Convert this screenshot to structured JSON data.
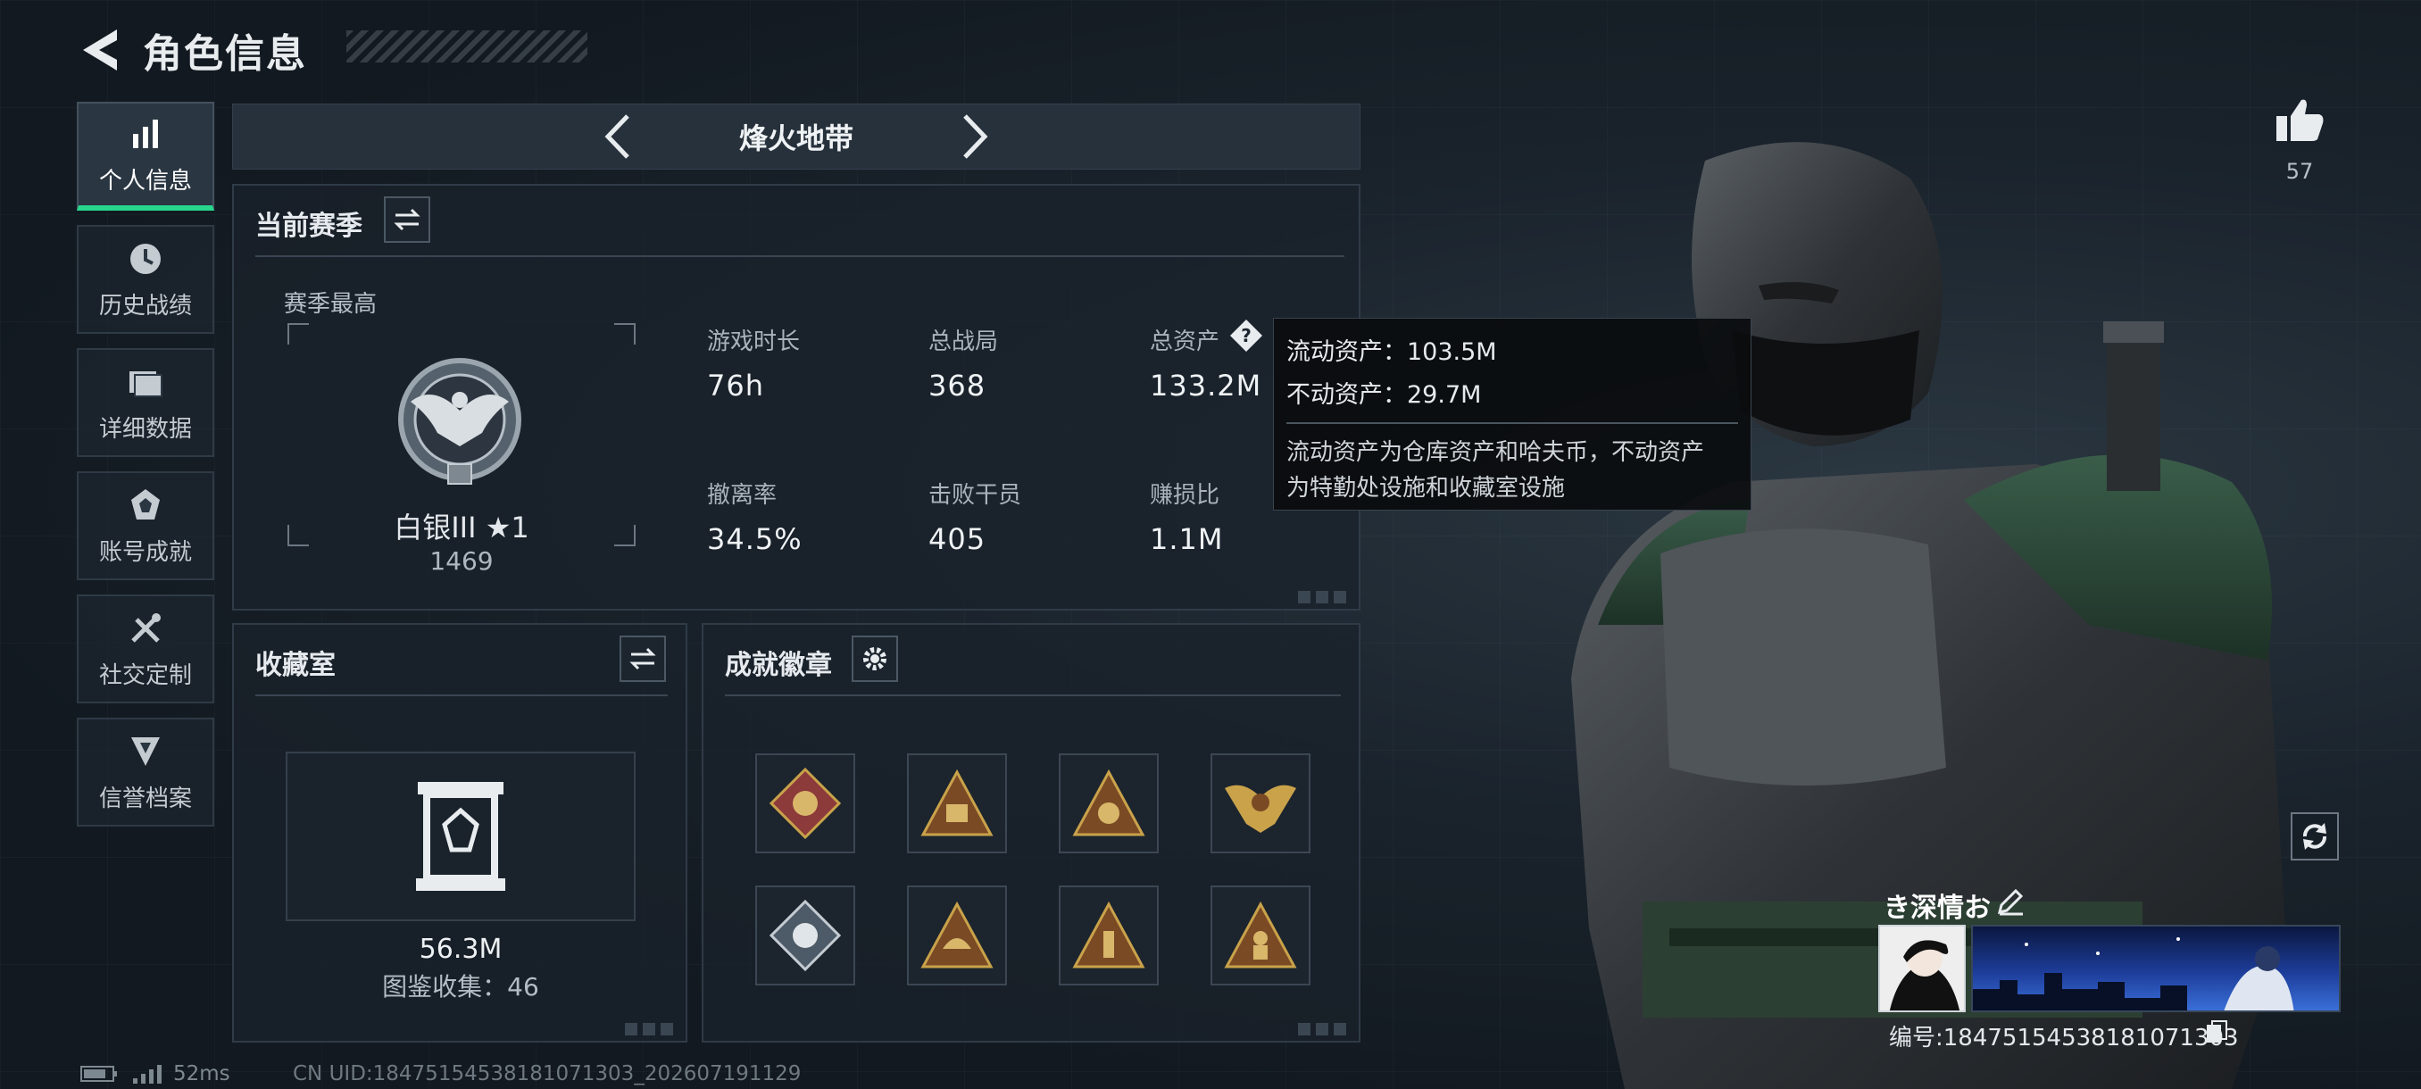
{
  "header": {
    "title": "角色信息"
  },
  "nav": {
    "items": [
      {
        "label": "个人信息",
        "icon": "bar-chart-icon",
        "active": true
      },
      {
        "label": "历史战绩",
        "icon": "clock-icon",
        "active": false
      },
      {
        "label": "详细数据",
        "icon": "folder-icon",
        "active": false
      },
      {
        "label": "账号成就",
        "icon": "achievement-icon",
        "active": false
      },
      {
        "label": "社交定制",
        "icon": "tools-icon",
        "active": false
      },
      {
        "label": "信誉档案",
        "icon": "credit-icon",
        "active": false
      }
    ]
  },
  "mode": {
    "title": "烽火地带"
  },
  "season": {
    "title": "当前赛季",
    "best_label": "赛季最高",
    "rank_name": "白银III ★1",
    "rank_score": "1469",
    "stats": [
      {
        "label": "游戏时长",
        "value": "76h"
      },
      {
        "label": "总战局",
        "value": "368"
      },
      {
        "label": "总资产",
        "value": "133.2M"
      },
      {
        "label": "撤离率",
        "value": "34.5%"
      },
      {
        "label": "击败干员",
        "value": "405"
      },
      {
        "label": "赚损比",
        "value": "1.1M"
      }
    ]
  },
  "tooltip": {
    "liquid": "流动资产：103.5M",
    "fixed": "不动资产：29.7M",
    "desc_line1": "流动资产为仓库资产和哈夫币，不动资产",
    "desc_line2": "为特勤处设施和收藏室设施"
  },
  "collection": {
    "title": "收藏室",
    "value": "56.3M",
    "count_label": "图鉴收集：46"
  },
  "badges": {
    "title": "成就徽章",
    "items": [
      "badge-1",
      "badge-2",
      "badge-3",
      "badge-4",
      "badge-5",
      "badge-6",
      "badge-7",
      "badge-8"
    ]
  },
  "profile": {
    "likes": "57",
    "name": "き深情お",
    "id_label": "编号:18475154538181071303"
  },
  "status": {
    "ping": "52ms",
    "uid": "CN UID:18475154538181071303_202607191129"
  },
  "colors": {
    "accent": "#27d68c",
    "gold": "#c9a24a"
  }
}
